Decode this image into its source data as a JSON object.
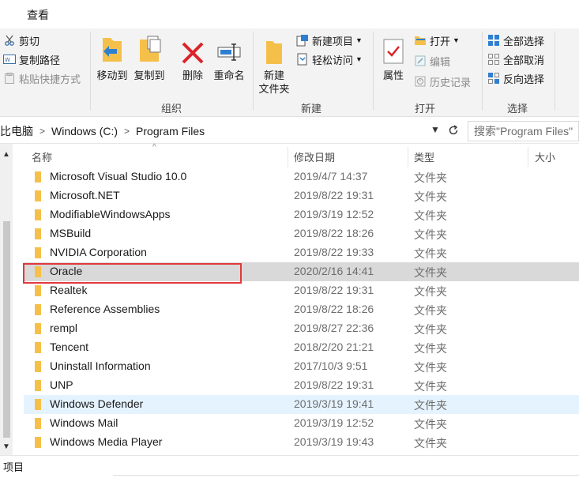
{
  "tabs": {
    "view_label": "查看"
  },
  "ribbon": {
    "clipboard": {
      "cut_label": "剪切",
      "copy_path_label": "复制路径",
      "paste_shortcut_label": "粘贴快捷方式"
    },
    "organize": {
      "move_to_label": "移动到",
      "copy_to_label": "复制到",
      "delete_label": "删除",
      "rename_label": "重命名",
      "group_label": "组织"
    },
    "new": {
      "new_folder_line1": "新建",
      "new_folder_line2": "文件夹",
      "new_item_label": "新建项目",
      "easy_access_label": "轻松访问",
      "group_label": "新建"
    },
    "open": {
      "properties_label": "属性",
      "open_label": "打开",
      "edit_label": "编辑",
      "history_label": "历史记录",
      "group_label": "打开"
    },
    "select": {
      "select_all_label": "全部选择",
      "select_none_label": "全部取消",
      "invert_selection_label": "反向选择",
      "group_label": "选择"
    }
  },
  "address": {
    "crumbs": [
      "比电脑",
      "Windows (C:)",
      "Program Files"
    ],
    "search_placeholder": "搜索\"Program Files\""
  },
  "columns": {
    "name": "名称",
    "modified": "修改日期",
    "type": "类型",
    "size": "大小"
  },
  "files": [
    {
      "name": "Microsoft Visual Studio 10.0",
      "modified": "2019/4/7 14:37",
      "type": "文件夹"
    },
    {
      "name": "Microsoft.NET",
      "modified": "2019/8/22 19:31",
      "type": "文件夹"
    },
    {
      "name": "ModifiableWindowsApps",
      "modified": "2019/3/19 12:52",
      "type": "文件夹"
    },
    {
      "name": "MSBuild",
      "modified": "2019/8/22 18:26",
      "type": "文件夹"
    },
    {
      "name": "NVIDIA Corporation",
      "modified": "2019/8/22 19:33",
      "type": "文件夹"
    },
    {
      "name": "Oracle",
      "modified": "2020/2/16 14:41",
      "type": "文件夹"
    },
    {
      "name": "Realtek",
      "modified": "2019/8/22 19:31",
      "type": "文件夹"
    },
    {
      "name": "Reference Assemblies",
      "modified": "2019/8/22 18:26",
      "type": "文件夹"
    },
    {
      "name": "rempl",
      "modified": "2019/8/27 22:36",
      "type": "文件夹"
    },
    {
      "name": "Tencent",
      "modified": "2018/2/20 21:21",
      "type": "文件夹"
    },
    {
      "name": "Uninstall Information",
      "modified": "2017/10/3 9:51",
      "type": "文件夹"
    },
    {
      "name": "UNP",
      "modified": "2019/8/22 19:31",
      "type": "文件夹"
    },
    {
      "name": "Windows Defender",
      "modified": "2019/3/19 19:41",
      "type": "文件夹"
    },
    {
      "name": "Windows Mail",
      "modified": "2019/3/19 12:52",
      "type": "文件夹"
    },
    {
      "name": "Windows Media Player",
      "modified": "2019/3/19 19:43",
      "type": "文件夹"
    }
  ],
  "status": {
    "text": "项目"
  },
  "colors": {
    "folder": "#f5c04a",
    "selection": "#d9d9d9",
    "hover": "#e5f3ff",
    "highlight_box": "#e0393e"
  }
}
